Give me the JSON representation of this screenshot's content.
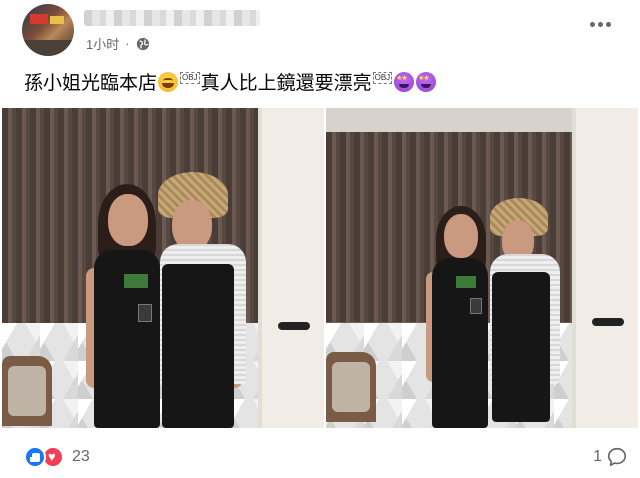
{
  "post": {
    "timestamp": "1小时",
    "audience_icon": "globe-icon",
    "menu_icon": "more-horizontal-icon",
    "caption": {
      "part1": "孫小姐光臨本店",
      "emoji1": "grinning-face-emoji",
      "obj1": "OBJ",
      "part2": "真人比上鏡還要漂亮",
      "obj2": "OBJ",
      "emoji2": "star-struck-emoji"
    },
    "photos": [
      {
        "name": "photo-left",
        "content": "two-women-standing-photo"
      },
      {
        "name": "photo-right",
        "content": "two-women-standing-photo"
      }
    ],
    "reactions": {
      "icons": [
        "like-icon",
        "love-icon"
      ],
      "count": "23"
    },
    "comments": {
      "count": "1",
      "icon": "comment-icon"
    }
  },
  "colors": {
    "like_blue": "#1877f2",
    "love_red": "#f33e58",
    "meta_gray": "#65676b"
  }
}
